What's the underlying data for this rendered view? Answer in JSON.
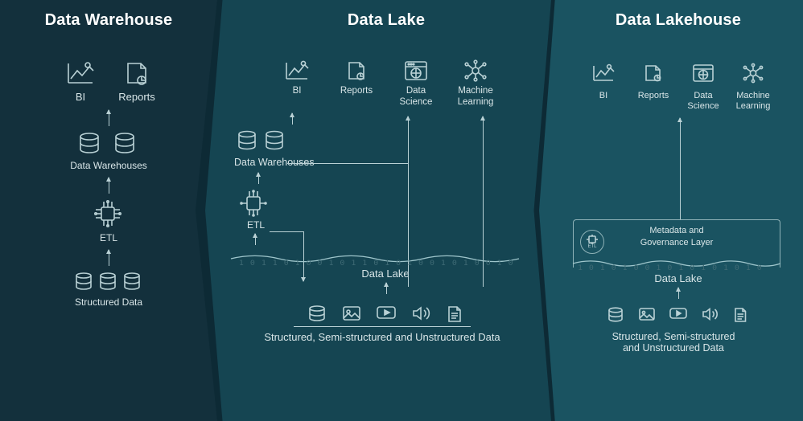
{
  "columns": {
    "warehouse": {
      "title": "Data Warehouse",
      "top": {
        "bi": "BI",
        "reports": "Reports"
      },
      "dw_label": "Data Warehouses",
      "etl_label": "ETL",
      "source_label": "Structured Data"
    },
    "lake": {
      "title": "Data Lake",
      "top": {
        "bi": "BI",
        "reports": "Reports",
        "ds": "Data\nScience",
        "ml": "Machine\nLearning"
      },
      "dw_label": "Data Warehouses",
      "etl_label": "ETL",
      "lake_label": "Data Lake",
      "source_label": "Structured, Semi-structured and Unstructured Data"
    },
    "lakehouse": {
      "title": "Data Lakehouse",
      "top": {
        "bi": "BI",
        "reports": "Reports",
        "ds": "Data\nScience",
        "ml": "Machine\nLearning"
      },
      "meta_label": "Metadata and\nGovernance Layer",
      "etl_badge": "ETL",
      "lake_label": "Data Lake",
      "source_label": "Structured, Semi-structured\nand Unstructured Data"
    }
  },
  "icons": {
    "bi": "bi-chart-icon",
    "reports": "report-page-icon",
    "ds": "globe-window-icon",
    "ml": "neural-network-icon",
    "db": "database-icon",
    "etl": "etl-chip-icon",
    "image": "image-icon",
    "video": "video-icon",
    "audio": "audio-icon",
    "document": "document-icon"
  }
}
